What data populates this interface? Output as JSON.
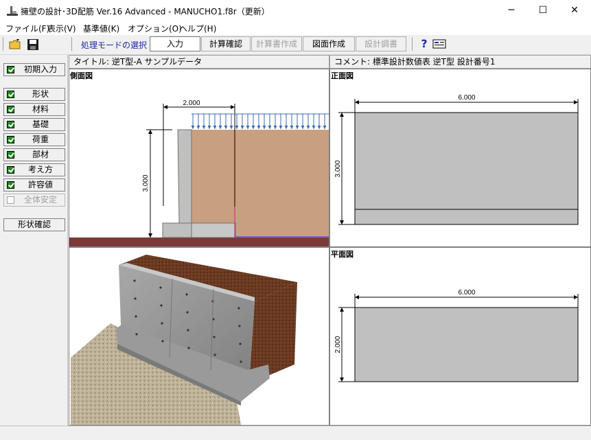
{
  "window": {
    "title": "擁壁の設計･3D配筋 Ver.16 Advanced  - MANUCHO1.f8r（更新）",
    "minimize": "─",
    "maximize": "☐",
    "close": "✕"
  },
  "menu": [
    {
      "label": "ファイル(F)"
    },
    {
      "label": "表示(V)"
    },
    {
      "label": "基準値(K)"
    },
    {
      "label": "オプション(O)"
    },
    {
      "label": "ヘルプ(H)"
    }
  ],
  "toolbar": {
    "mode_label": "処理モードの選択",
    "buttons": [
      {
        "label": "入力",
        "state": "active"
      },
      {
        "label": "計算確認",
        "state": "normal"
      },
      {
        "label": "計算書作成",
        "state": "disabled"
      },
      {
        "label": "図面作成",
        "state": "normal"
      },
      {
        "label": "設計調書",
        "state": "disabled"
      }
    ],
    "help_icon": "question-icon",
    "info_icon": "card-icon"
  },
  "sidebar": {
    "initial": "初期入力",
    "items": [
      {
        "label": "形状",
        "checked": true
      },
      {
        "label": "材料",
        "checked": true
      },
      {
        "label": "基礎",
        "checked": true
      },
      {
        "label": "荷重",
        "checked": true
      },
      {
        "label": "部材",
        "checked": true
      },
      {
        "label": "考え方",
        "checked": true
      },
      {
        "label": "許容値",
        "checked": true
      },
      {
        "label": "全体安定",
        "checked": false
      }
    ],
    "shape_confirm": "形状確認"
  },
  "info": {
    "title": "タイトル: 逆T型-A サンプルデータ",
    "comment": "コメント: 標準設計数値表  逆T型  設計番号1"
  },
  "views": {
    "side": {
      "label": "側面図",
      "width_dim": "2.000",
      "height_dim": "3.000"
    },
    "front": {
      "label": "正面図",
      "width_dim": "6.000",
      "height_dim": "3.000"
    },
    "plan": {
      "label": "平面図",
      "width_dim": "6.000",
      "height_dim": "2.000"
    }
  },
  "colors": {
    "soil": "#c8a080",
    "ground": "#7a3a3a",
    "concrete": "#c0c0c0",
    "load_arrow": "#3a6ab0",
    "check_green": "#1e8c1e"
  }
}
